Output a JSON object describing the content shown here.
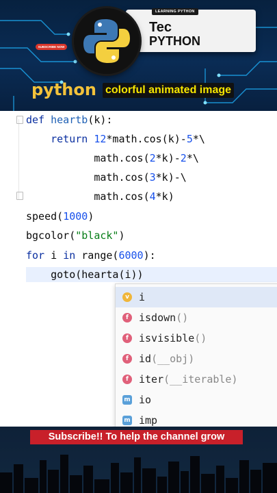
{
  "banner": {
    "learning_chip": "LEARNING PYTHON",
    "title_line1": "Tec",
    "title_line2": "PYTHON",
    "subscribe_pill": "SUBSCRIBE NOW",
    "python_word": "python",
    "caption": "colorful animated image",
    "colors": {
      "gold": "#f3c23a",
      "yellow": "#f7e600",
      "red": "#d9362b"
    }
  },
  "editor": {
    "lines": [
      {
        "parts": [
          {
            "t": "def ",
            "c": "kw"
          },
          {
            "t": "heartb",
            "c": "fn"
          },
          {
            "t": "(k):",
            "c": ""
          }
        ]
      },
      {
        "parts": [
          {
            "t": "    return ",
            "c": "kw"
          },
          {
            "t": "12",
            "c": "num"
          },
          {
            "t": "*math.cos(k)-",
            "c": ""
          },
          {
            "t": "5",
            "c": "num"
          },
          {
            "t": "*\\",
            "c": ""
          }
        ]
      },
      {
        "parts": [
          {
            "t": "           math.cos(",
            "c": ""
          },
          {
            "t": "2",
            "c": "num"
          },
          {
            "t": "*k)-",
            "c": ""
          },
          {
            "t": "2",
            "c": "num"
          },
          {
            "t": "*\\",
            "c": ""
          }
        ]
      },
      {
        "parts": [
          {
            "t": "           math.cos(",
            "c": ""
          },
          {
            "t": "3",
            "c": "num"
          },
          {
            "t": "*k)-\\",
            "c": ""
          }
        ]
      },
      {
        "parts": [
          {
            "t": "           math.cos(",
            "c": ""
          },
          {
            "t": "4",
            "c": "num"
          },
          {
            "t": "*k)",
            "c": ""
          }
        ]
      },
      {
        "parts": [
          {
            "t": "speed(",
            "c": ""
          },
          {
            "t": "1000",
            "c": "num"
          },
          {
            "t": ")",
            "c": ""
          }
        ]
      },
      {
        "parts": [
          {
            "t": "bgcolor(",
            "c": ""
          },
          {
            "t": "\"black\"",
            "c": "str"
          },
          {
            "t": ")",
            "c": ""
          }
        ]
      },
      {
        "parts": [
          {
            "t": "for ",
            "c": "kw"
          },
          {
            "t": "i ",
            "c": ""
          },
          {
            "t": "in ",
            "c": "kw"
          },
          {
            "t": "range(",
            "c": ""
          },
          {
            "t": "6000",
            "c": "num"
          },
          {
            "t": "):",
            "c": ""
          }
        ]
      },
      {
        "parts": [
          {
            "t": "    goto(hearta(i))",
            "c": ""
          }
        ]
      }
    ],
    "completion": [
      {
        "badge": "v",
        "kind": "variable",
        "name": "i",
        "args": ""
      },
      {
        "badge": "f",
        "kind": "function",
        "name": "isdown",
        "args": "()"
      },
      {
        "badge": "f",
        "kind": "function",
        "name": "isvisible",
        "args": "()"
      },
      {
        "badge": "f",
        "kind": "function",
        "name": "id",
        "args": "(__obj)"
      },
      {
        "badge": "f",
        "kind": "function",
        "name": "iter",
        "args": "(__iterable)"
      },
      {
        "badge": "m",
        "kind": "module",
        "name": "io",
        "args": ""
      },
      {
        "badge": "m",
        "kind": "module",
        "name": "imp",
        "args": ""
      }
    ]
  },
  "footer": {
    "cta": "Subscribe!! To help the channel grow",
    "colors": {
      "cta_bg": "#c8202a"
    }
  }
}
